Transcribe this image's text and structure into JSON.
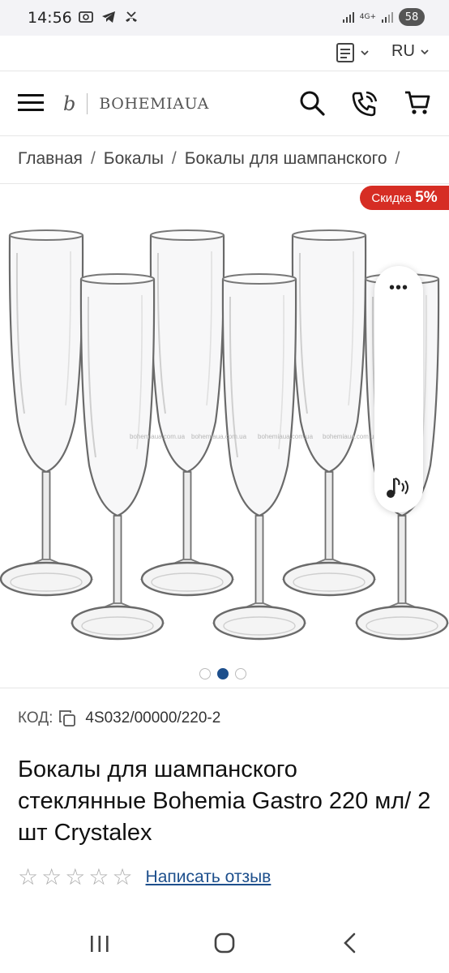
{
  "status_bar": {
    "time": "14:56",
    "network": "4G+",
    "battery": "58",
    "icons_left": [
      "screenshot-icon",
      "telegram-icon",
      "missed-call-icon"
    ],
    "icons_right": [
      "signal-icon",
      "signal-icon",
      "battery-icon"
    ]
  },
  "top_bar": {
    "language": "RU"
  },
  "header": {
    "logo_mark": "b",
    "logo_text": "BOHEMIAUA"
  },
  "breadcrumb": {
    "items": [
      "Главная",
      "Бокалы",
      "Бокалы для шампанского"
    ],
    "separator": "/"
  },
  "product": {
    "discount_label": "Скидка",
    "discount_value": "5%",
    "watermark": "bohemiaua.com.ua",
    "gallery_dots": 3,
    "active_dot": 2,
    "sku_label": "КОД:",
    "sku_value": "4S032/00000/220-2",
    "title": "Бокалы для шампанского стеклянные Bohemia Gastro 220 мл/ 2 шт Crystalex",
    "rating_stars": 0,
    "rating_max": 5,
    "review_link": "Написать отзыв"
  },
  "colors": {
    "discount": "#d62d24",
    "accent_blue": "#1d4f8c",
    "text": "#222222"
  }
}
